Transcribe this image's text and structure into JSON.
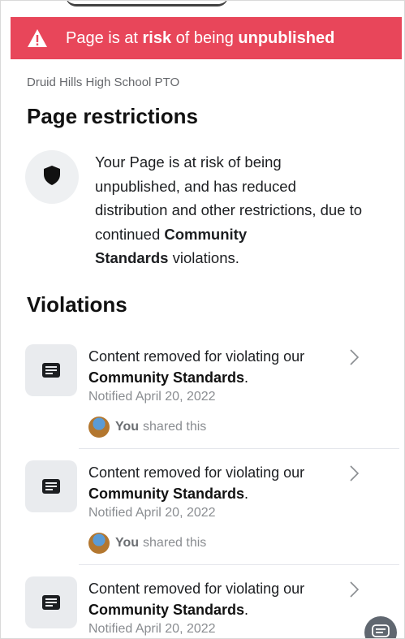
{
  "banner": {
    "text_pre": "Page is at ",
    "text_risk": "risk",
    "text_mid": " of being ",
    "text_unpub": "unpublished",
    "color": "#e8465a"
  },
  "page": {
    "name": "Druid Hills High School PTO"
  },
  "restrictions": {
    "title": "Page restrictions",
    "text": "Your Page is at risk of being unpublished, and has reduced distribution and other restrictions, due to continued ",
    "bold1": "Community",
    "bold2": "Standards",
    "text_end": " violations."
  },
  "violations": {
    "title": "Violations",
    "items": [
      {
        "line1": "Content removed for violating our",
        "line2": "Community Standards",
        "line2_end": ".",
        "date": "Notified April 20, 2022",
        "shared_you": "You",
        "shared_rest": "shared this"
      },
      {
        "line1": "Content removed for violating our",
        "line2": "Community Standards",
        "line2_end": ".",
        "date": "Notified April 20, 2022",
        "shared_you": "You",
        "shared_rest": "shared this"
      },
      {
        "line1": "Content removed for violating our",
        "line2": "Community Standards",
        "line2_end": ".",
        "date": "Notified April 20, 2022"
      }
    ]
  },
  "icons": {
    "banner": "warning-triangle-icon",
    "restriction": "shield-icon",
    "violation": "document-icon",
    "chevron": "chevron-right-icon",
    "fab": "feedback-icon"
  }
}
